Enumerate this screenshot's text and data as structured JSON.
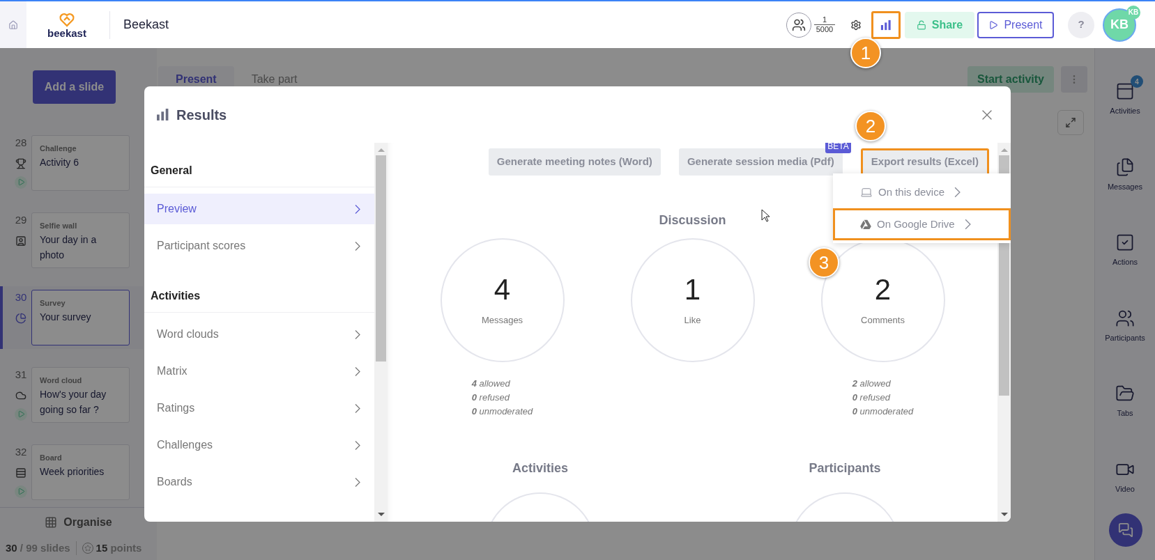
{
  "top_bar": {
    "logo_text": "beekast",
    "title": "Beekast",
    "participants": {
      "count": "1",
      "limit": "5000"
    },
    "results_button": {
      "highlighted": true
    },
    "share_button": "Share",
    "present_button": "Present",
    "help_button": "?",
    "avatar": {
      "initials": "KB",
      "badge": "KB"
    }
  },
  "sidebar": {
    "add_button": "Add a slide",
    "slides": [
      {
        "number": "28",
        "kind": "challenge",
        "type": "Challenge",
        "title": "Activity 6",
        "playable": true,
        "selected": false
      },
      {
        "number": "29",
        "kind": "selfie",
        "type": "Selfie wall",
        "title": "Your day in a photo",
        "playable": false,
        "selected": false
      },
      {
        "number": "30",
        "kind": "survey",
        "type": "Survey",
        "title": "Your survey",
        "playable": false,
        "selected": true
      },
      {
        "number": "31",
        "kind": "wordcloud",
        "type": "Word cloud",
        "title": "How's your day going so far ?",
        "playable": true,
        "selected": false
      },
      {
        "number": "32",
        "kind": "board",
        "type": "Board",
        "title": "Week priorities",
        "playable": true,
        "selected": false
      }
    ],
    "organise_button": "Organise",
    "slide_count": "**30** / 99 slides",
    "points": "**15** points"
  },
  "stage": {
    "tabs": [
      {
        "label": "Present",
        "selected": true
      },
      {
        "label": "Take part",
        "selected": false
      }
    ],
    "start_button": "Start activity"
  },
  "right_rail": {
    "items": [
      {
        "kind": "activities",
        "label": "Activities",
        "badge": "4"
      },
      {
        "kind": "messages",
        "label": "Messages"
      },
      {
        "kind": "actions",
        "label": "Actions"
      },
      {
        "kind": "participants",
        "label": "Participants"
      },
      {
        "kind": "tabs",
        "label": "Tabs"
      },
      {
        "kind": "video",
        "label": "Video"
      }
    ]
  },
  "results_dialog": {
    "title": "Results",
    "nav": [
      {
        "heading": "General",
        "items": [
          {
            "label": "Preview",
            "selected": true
          },
          {
            "label": "Participant scores",
            "selected": false
          }
        ]
      },
      {
        "heading": "Activities",
        "items": [
          {
            "label": "Word clouds",
            "selected": false
          },
          {
            "label": "Matrix",
            "selected": false
          },
          {
            "label": "Ratings",
            "selected": false
          },
          {
            "label": "Challenges",
            "selected": false
          },
          {
            "label": "Boards",
            "selected": false
          }
        ]
      }
    ],
    "actions": [
      {
        "label": "Generate meeting notes (Word)",
        "highlighted": false
      },
      {
        "label": "Generate session media (Pdf)",
        "badge": "BETA",
        "highlighted": false
      },
      {
        "label": "Export results (Excel)",
        "highlighted": true
      }
    ],
    "export_menu": [
      {
        "kind": "device",
        "label": "On this device",
        "highlighted": false
      },
      {
        "kind": "drive",
        "label": "On Google Drive",
        "highlighted": true
      }
    ],
    "discussion": {
      "heading": "Discussion",
      "stats": [
        {
          "value": "4",
          "label": "Messages",
          "details": [
            "**4** allowed",
            "**0** refused",
            "**0** unmoderated"
          ]
        },
        {
          "value": "1",
          "label": "Like"
        },
        {
          "value": "2",
          "label": "Comments",
          "details": [
            "**2** allowed",
            "**0** refused",
            "**0** unmoderated"
          ]
        }
      ]
    },
    "sections": [
      {
        "heading": "Activities"
      },
      {
        "heading": "Participants"
      }
    ]
  },
  "annotations": [
    {
      "label": "1"
    },
    {
      "label": "2"
    },
    {
      "label": "3"
    }
  ]
}
